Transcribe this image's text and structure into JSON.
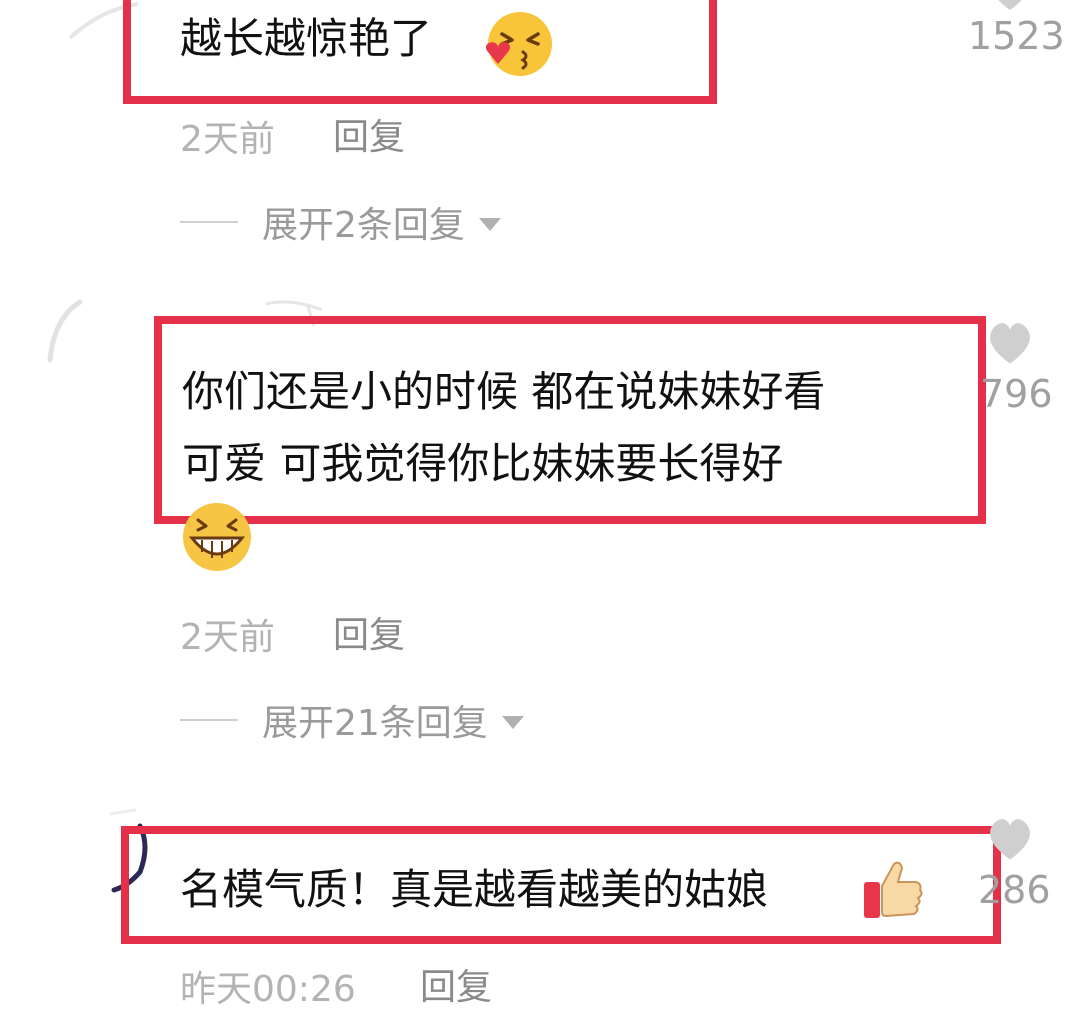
{
  "comments": [
    {
      "text": "越长越惊艳了",
      "time": "2天前",
      "reply_label": "回复",
      "expand_label": "展开2条回复",
      "like_count": "1523",
      "emoji": "kissing-face-icon"
    },
    {
      "text_line1": "你们还是小的时候 都在说妹妹好看",
      "text_line2": "可爱 可我觉得你比妹妹要长得好",
      "time": "2天前",
      "reply_label": "回复",
      "expand_label": "展开21条回复",
      "like_count": "796",
      "emoji": "grinning-face-icon"
    },
    {
      "text": "名模气质！真是越看越美的姑娘",
      "time": "昨天00:26",
      "reply_label": "回复",
      "like_count": "286",
      "emoji": "thumbs-up-icon"
    }
  ],
  "colors": {
    "highlight": "#e5304a",
    "text": "#111111",
    "meta": "#b3b3b3",
    "reply": "#8a8a8a"
  }
}
